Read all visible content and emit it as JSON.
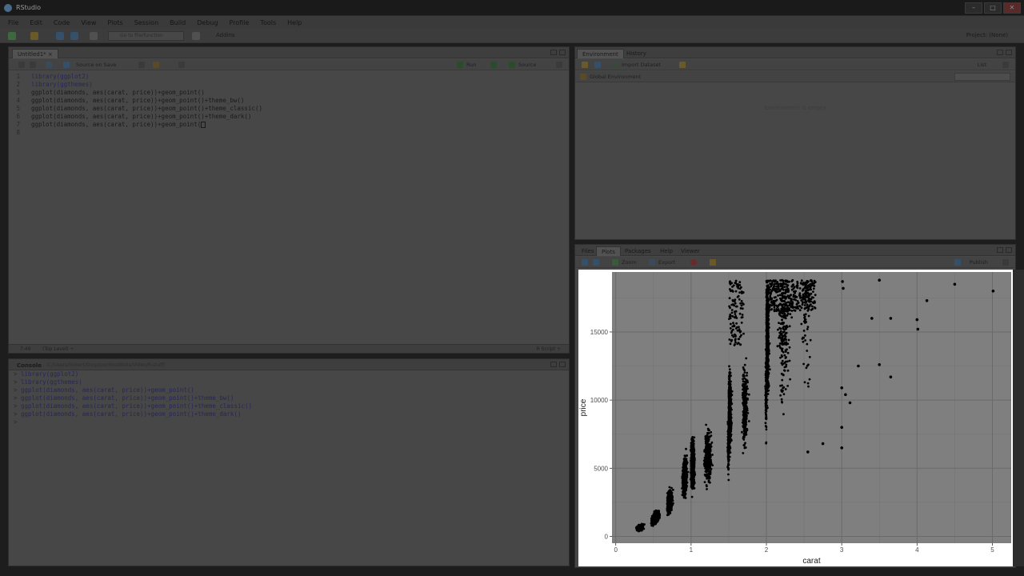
{
  "window": {
    "title": "RStudio"
  },
  "menu": [
    "File",
    "Edit",
    "Code",
    "View",
    "Plots",
    "Session",
    "Build",
    "Debug",
    "Profile",
    "Tools",
    "Help"
  ],
  "toolbar": {
    "goto_placeholder": "Go to file/function",
    "addins_label": "Addins",
    "project_label": "Project: (None)"
  },
  "editor": {
    "tab_label": "Untitled1*",
    "source_on_save_label": "Source on Save",
    "run_label": "Run",
    "source_label": "Source",
    "lines": [
      {
        "num": "1",
        "pre": "library",
        "rest": "(ggplot2)"
      },
      {
        "num": "2",
        "pre": "library",
        "rest": "(ggthemes)"
      },
      {
        "num": "3",
        "pre": "",
        "rest": "ggplot(diamonds, aes(carat, price))+geom_point()"
      },
      {
        "num": "4",
        "pre": "",
        "rest": "ggplot(diamonds, aes(carat, price))+geom_point()+theme_bw()"
      },
      {
        "num": "5",
        "pre": "",
        "rest": "ggplot(diamonds, aes(carat, price))+geom_point()+theme_classic()"
      },
      {
        "num": "6",
        "pre": "",
        "rest": "ggplot(diamonds, aes(carat, price))+geom_point()+theme_dark()"
      },
      {
        "num": "7",
        "pre": "",
        "rest": "ggplot(diamonds, aes(carat, price))+geom_point("
      },
      {
        "num": "8",
        "pre": "",
        "rest": ""
      }
    ],
    "status_position": "7:49",
    "status_scope": "(Top Level) ÷",
    "status_type": "R Script ÷"
  },
  "console": {
    "tab_label": "Console",
    "path": "C:/Users/Robert/Dropbox/MeetBeta/Video/R-stuff/",
    "lines": [
      "library(ggplot2)",
      "library(ggthemes)",
      "ggplot(diamonds, aes(carat, price))+geom_point()",
      "ggplot(diamonds, aes(carat, price))+geom_point()+theme_bw()",
      "ggplot(diamonds, aes(carat, price))+geom_point()+theme_classic()",
      "ggplot(diamonds, aes(carat, price))+geom_point()+theme_dark()",
      ""
    ],
    "prompt": ">"
  },
  "environment": {
    "tabs": [
      "Environment",
      "History"
    ],
    "import_label": "Import Dataset",
    "scope_label": "Global Environment",
    "list_label": "List",
    "empty_text": "Environment is empty"
  },
  "plots_pane": {
    "tabs": [
      "Files",
      "Plots",
      "Packages",
      "Help",
      "Viewer"
    ],
    "zoom_label": "Zoom",
    "export_label": "Export",
    "publish_label": "Publish"
  },
  "chart_data": {
    "type": "scatter",
    "title": "",
    "xlabel": "carat",
    "ylabel": "price",
    "xlim": [
      -0.05,
      5.25
    ],
    "ylim": [
      -500,
      19400
    ],
    "x_ticks": [
      0,
      1,
      2,
      3,
      4,
      5
    ],
    "y_ticks": [
      0,
      5000,
      10000,
      15000
    ],
    "grid": true,
    "theme": "dark",
    "panel_color": "#7f7f7f",
    "point_color": "#000000",
    "outliers": [
      {
        "x": 3.01,
        "y": 18700
      },
      {
        "x": 3.02,
        "y": 18200
      },
      {
        "x": 3.5,
        "y": 18800
      },
      {
        "x": 4.5,
        "y": 18500
      },
      {
        "x": 5.01,
        "y": 18000
      },
      {
        "x": 4.13,
        "y": 17300
      },
      {
        "x": 3.4,
        "y": 16000
      },
      {
        "x": 3.65,
        "y": 16000
      },
      {
        "x": 4.0,
        "y": 15900
      },
      {
        "x": 4.01,
        "y": 15200
      },
      {
        "x": 3.22,
        "y": 12500
      },
      {
        "x": 3.5,
        "y": 12600
      },
      {
        "x": 3.65,
        "y": 11700
      },
      {
        "x": 3.0,
        "y": 10900
      },
      {
        "x": 3.05,
        "y": 10400
      },
      {
        "x": 3.11,
        "y": 9800
      },
      {
        "x": 3.0,
        "y": 8000
      },
      {
        "x": 3.0,
        "y": 6500
      },
      {
        "x": 2.75,
        "y": 6800
      },
      {
        "x": 2.55,
        "y": 6200
      }
    ]
  }
}
